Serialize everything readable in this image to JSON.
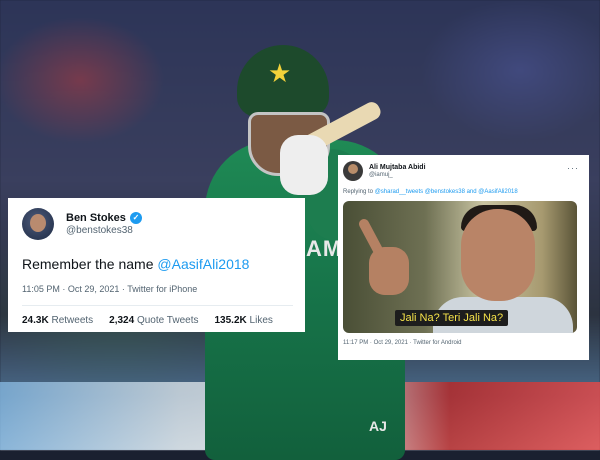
{
  "tweet_main": {
    "display_name": "Ben Stokes",
    "handle": "@benstokes38",
    "text_prefix": "Remember the name ",
    "mention": "@AasifAli2018",
    "time": "11:05 PM · Oct 29, 2021 · Twitter for iPhone",
    "retweets_count": "24.3K",
    "retweets_label": "Retweets",
    "quotes_count": "2,324",
    "quotes_label": "Quote Tweets",
    "likes_count": "135.2K",
    "likes_label": "Likes",
    "verified_glyph": "✓"
  },
  "tweet_reply": {
    "display_name": "Ali Mujtaba Abidi",
    "handle": "@iamuj_",
    "more_glyph": "···",
    "replying_prefix": "Replying to ",
    "replying_to": "@sharad__tweets @benstokes38 and @AasifAli2018",
    "meme_caption": "Jali Na? Teri Jali Na?",
    "time": "11:17 PM · Oct 29, 2021 · Twitter for Android"
  },
  "background": {
    "jersey_text": "AM",
    "helmet_badge": "★",
    "shirt_logo": "AJ"
  },
  "colors": {
    "twitter_blue": "#1d9bf0",
    "jersey_green": "#1f8a55",
    "caption_yellow": "#f5e24a"
  },
  "icons": [
    "verified-badge-icon",
    "more-options-icon",
    "star-icon"
  ]
}
